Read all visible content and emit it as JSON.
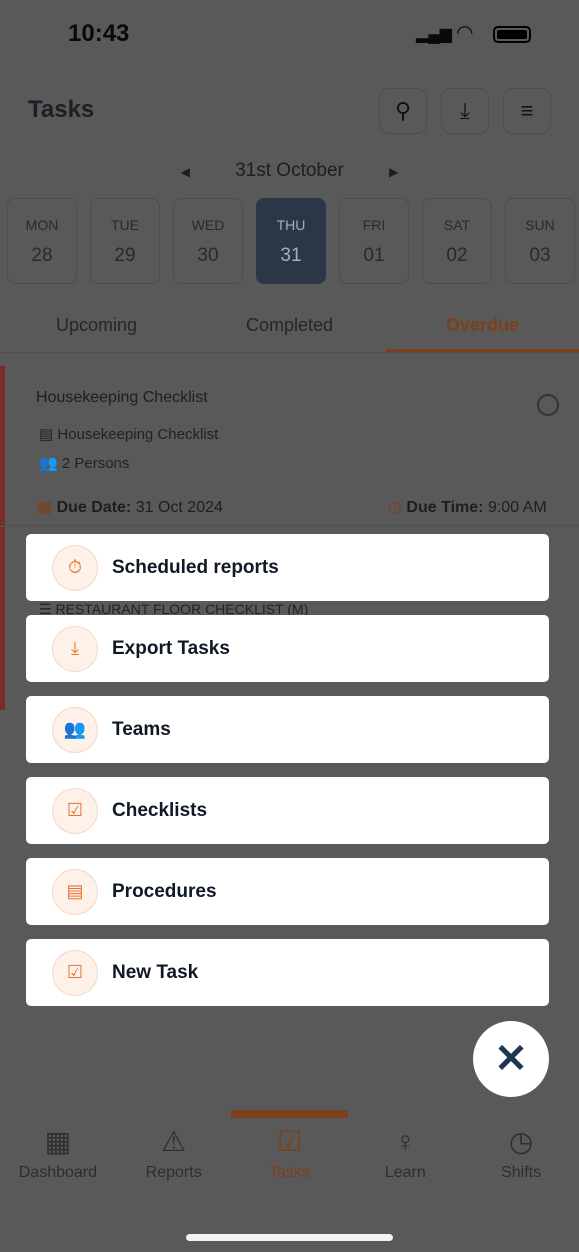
{
  "status": {
    "time": "10:43"
  },
  "header": {
    "title": "Tasks",
    "icons": [
      "search-icon",
      "download-icon",
      "filter-icon"
    ]
  },
  "date_nav": {
    "label": "31st October"
  },
  "days": [
    {
      "name": "MON",
      "num": "28"
    },
    {
      "name": "TUE",
      "num": "29"
    },
    {
      "name": "WED",
      "num": "30"
    },
    {
      "name": "THU",
      "num": "31",
      "active": true
    },
    {
      "name": "FRI",
      "num": "01"
    },
    {
      "name": "SAT",
      "num": "02"
    },
    {
      "name": "SUN",
      "num": "03"
    }
  ],
  "tabs": [
    {
      "label": "Upcoming"
    },
    {
      "label": "Completed"
    },
    {
      "label": "Overdue",
      "active": true
    }
  ],
  "tasks": [
    {
      "title": "Housekeeping Checklist",
      "checklist": "Housekeeping Checklist",
      "assignees": "2 Persons",
      "due_date_label": "Due Date:",
      "due_date": "31 Oct 2024",
      "due_time_label": "Due Time:",
      "due_time": "9:00 AM"
    },
    {
      "checklist": "RESTAURANT FLOOR CHECKLIST (M)"
    }
  ],
  "menu": [
    {
      "label": "Scheduled reports",
      "icon": "stopwatch-icon"
    },
    {
      "label": "Export Tasks",
      "icon": "download-icon"
    },
    {
      "label": "Teams",
      "icon": "users-icon"
    },
    {
      "label": "Checklists",
      "icon": "checkbox-icon"
    },
    {
      "label": "Procedures",
      "icon": "list-icon"
    },
    {
      "label": "New Task",
      "icon": "checkbox-icon"
    }
  ],
  "bottom_nav": [
    {
      "label": "Dashboard"
    },
    {
      "label": "Reports"
    },
    {
      "label": "Tasks",
      "active": true
    },
    {
      "label": "Learn"
    },
    {
      "label": "Shifts"
    }
  ],
  "colors": {
    "accent": "#e8742c",
    "navy": "#1f3554",
    "overdue": "#e53935"
  }
}
